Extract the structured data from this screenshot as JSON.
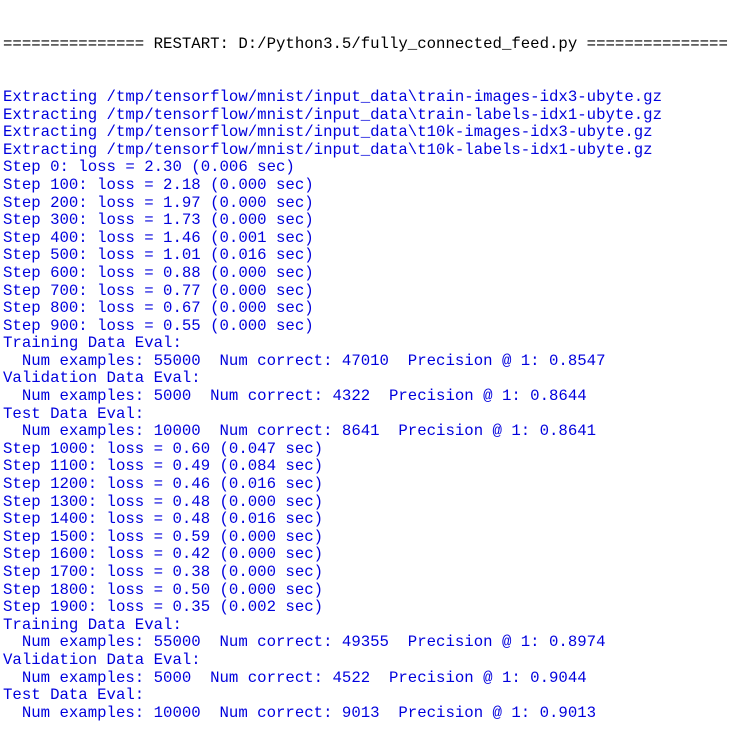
{
  "header": "=============== RESTART: D:/Python3.5/fully_connected_feed.py ===============",
  "output_color": "#0000dd",
  "lines": [
    "Extracting /tmp/tensorflow/mnist/input_data\\train-images-idx3-ubyte.gz",
    "Extracting /tmp/tensorflow/mnist/input_data\\train-labels-idx1-ubyte.gz",
    "Extracting /tmp/tensorflow/mnist/input_data\\t10k-images-idx3-ubyte.gz",
    "Extracting /tmp/tensorflow/mnist/input_data\\t10k-labels-idx1-ubyte.gz",
    "Step 0: loss = 2.30 (0.006 sec)",
    "Step 100: loss = 2.18 (0.000 sec)",
    "Step 200: loss = 1.97 (0.000 sec)",
    "Step 300: loss = 1.73 (0.000 sec)",
    "Step 400: loss = 1.46 (0.001 sec)",
    "Step 500: loss = 1.01 (0.016 sec)",
    "Step 600: loss = 0.88 (0.000 sec)",
    "Step 700: loss = 0.77 (0.000 sec)",
    "Step 800: loss = 0.67 (0.000 sec)",
    "Step 900: loss = 0.55 (0.000 sec)",
    "Training Data Eval:",
    "  Num examples: 55000  Num correct: 47010  Precision @ 1: 0.8547",
    "Validation Data Eval:",
    "  Num examples: 5000  Num correct: 4322  Precision @ 1: 0.8644",
    "Test Data Eval:",
    "  Num examples: 10000  Num correct: 8641  Precision @ 1: 0.8641",
    "Step 1000: loss = 0.60 (0.047 sec)",
    "Step 1100: loss = 0.49 (0.084 sec)",
    "Step 1200: loss = 0.46 (0.016 sec)",
    "Step 1300: loss = 0.48 (0.000 sec)",
    "Step 1400: loss = 0.48 (0.016 sec)",
    "Step 1500: loss = 0.59 (0.000 sec)",
    "Step 1600: loss = 0.42 (0.000 sec)",
    "Step 1700: loss = 0.38 (0.000 sec)",
    "Step 1800: loss = 0.50 (0.000 sec)",
    "Step 1900: loss = 0.35 (0.002 sec)",
    "Training Data Eval:",
    "  Num examples: 55000  Num correct: 49355  Precision @ 1: 0.8974",
    "Validation Data Eval:",
    "  Num examples: 5000  Num correct: 4522  Precision @ 1: 0.9044",
    "Test Data Eval:",
    "  Num examples: 10000  Num correct: 9013  Precision @ 1: 0.9013"
  ]
}
